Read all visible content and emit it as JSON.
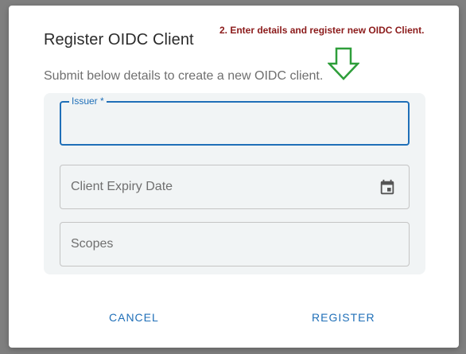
{
  "dialog": {
    "title": "Register OIDC Client",
    "subtitle": "Submit below details to create a new OIDC client.",
    "annotation": "2. Enter details and register new OIDC Client."
  },
  "fields": {
    "issuer_label": "Issuer *",
    "issuer_value": "",
    "expiry_placeholder": "Client Expiry Date",
    "scopes_placeholder": "Scopes"
  },
  "icons": {
    "expiry": "calendar-icon",
    "annotation_arrow": "arrow-down-icon"
  },
  "buttons": {
    "cancel": "CANCEL",
    "register": "REGISTER"
  },
  "colors": {
    "primary": "#1f6fb8",
    "annotation": "#8b1a1a",
    "arrow": "#2e9e3a"
  }
}
